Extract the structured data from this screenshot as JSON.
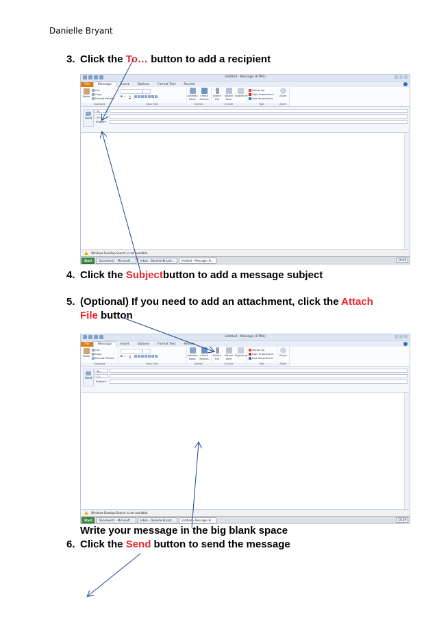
{
  "author": "Danielle Bryant",
  "steps": {
    "s3": {
      "num": "3.",
      "pre": "Click the ",
      "hl": "To…",
      "post": " button to add a recipient"
    },
    "s4": {
      "num": "4.",
      "pre": "Click the ",
      "hl": "Subject",
      "post": "button to add a message subject"
    },
    "s5": {
      "num": "5.",
      "pre": "(Optional) If you need to add an attachment, click the ",
      "hl": "Attach File",
      "post": " button"
    },
    "write": "Write your message in the big blank space",
    "s6": {
      "num": "6.",
      "pre": "Click the ",
      "hl": "Send",
      "post": " button to send the message"
    }
  },
  "outlook": {
    "title": "Untitled - Message (HTML)",
    "tabs": [
      "File",
      "Message",
      "Insert",
      "Options",
      "Format Text",
      "Review"
    ],
    "clipboard": {
      "paste": "Paste",
      "cut": "Cut",
      "copy": "Copy",
      "format_painter": "Format Painter",
      "label": "Clipboard"
    },
    "basic_text_label": "Basic Text",
    "names": {
      "address_book": "Address Book",
      "check_names": "Check Names",
      "label": "Names"
    },
    "include": {
      "attach_file": "Attach File",
      "attach_item": "Attach Item",
      "signature": "Signature",
      "label": "Include"
    },
    "tags": {
      "follow_up": "Follow Up",
      "high": "High Importance",
      "low": "Low Importance",
      "label": "Tags"
    },
    "zoom": {
      "zoom": "Zoom",
      "label": "Zoom"
    },
    "send": "Send",
    "to": "To...",
    "cc": "Cc...",
    "subject": "Subject:",
    "info": "Windows Desktop Search is not available.",
    "taskbar": [
      "Start",
      "Document1 - Microsoft ...",
      "Inbox - Danielle.Bryant...",
      "Untitled - Message (H..."
    ],
    "clock": "10:29"
  },
  "colors": {
    "highlight": "#e8262c",
    "arrow": "#1f3f8f",
    "file_tab": "#e07a14"
  }
}
